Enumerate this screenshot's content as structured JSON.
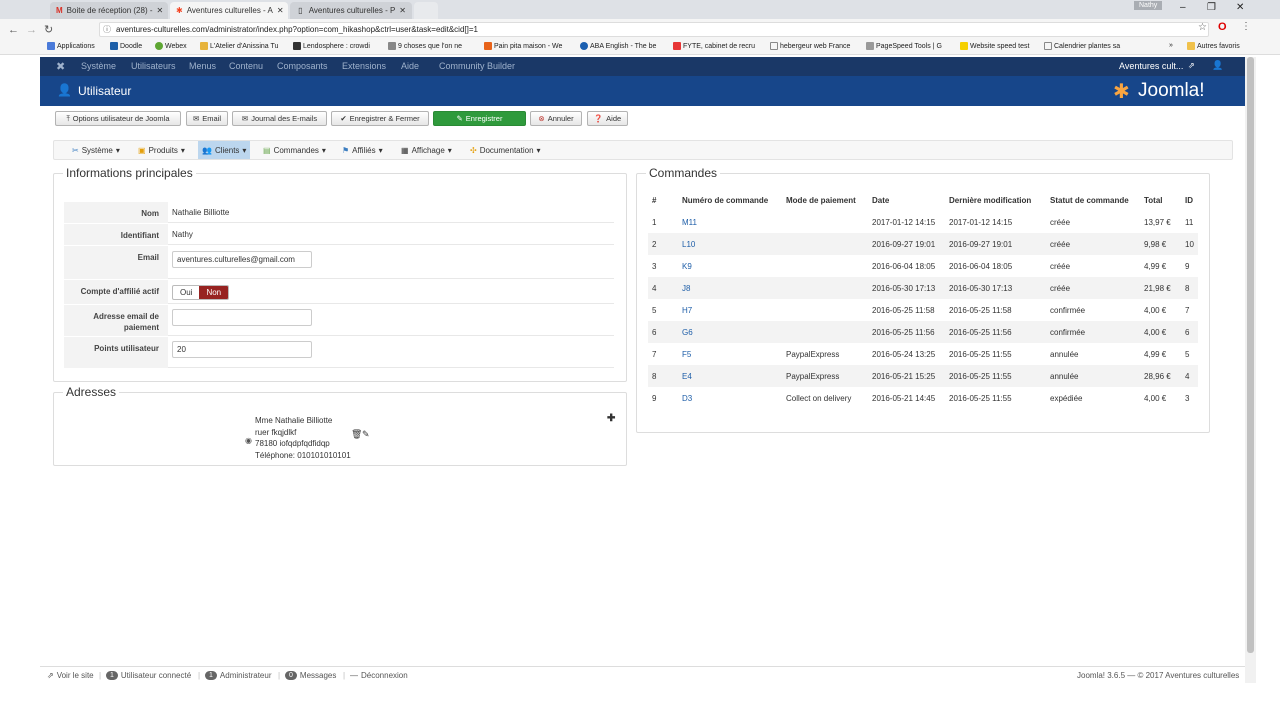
{
  "browser": {
    "tabs": [
      {
        "title": "Boite de réception (28) - ",
        "icon": "gmail-icon"
      },
      {
        "title": "Aventures culturelles - A",
        "icon": "joomla-icon"
      },
      {
        "title": "Aventures culturelles - P",
        "icon": "page-icon"
      }
    ],
    "user_label": "Nathy",
    "url": "aventures-culturelles.com/administrator/index.php?option=com_hikashop&ctrl=user&task=edit&cid[]=1",
    "bookmarks": [
      "Applications",
      "Doodle",
      "Webex",
      "L'Atelier d'Anissina Tu",
      "Lendosphere : crowdi",
      "9 choses que l'on ne",
      "Pain pita maison - We",
      "ABA English - The be",
      "FYTE, cabinet de recru",
      "hebergeur web France",
      "PageSpeed Tools | G",
      "Website speed test",
      "Calendrier plantes sa"
    ],
    "bookmarks_overflow": "»",
    "other_bookmarks": "Autres favoris"
  },
  "joomla": {
    "menu": [
      "Système",
      "Utilisateurs",
      "Menus",
      "Contenu",
      "Composants",
      "Extensions",
      "Aide",
      "Community Builder"
    ],
    "site_name": "Aventures cult...",
    "page_title": "Utilisateur",
    "logo_text": "Joomla!",
    "toolbar": {
      "options": "Options utilisateur de Joomla",
      "email": "Email",
      "journal": "Journal des E-mails",
      "save_close": "Enregistrer & Fermer",
      "save": "Enregistrer",
      "cancel": "Annuler",
      "help": "Aide"
    },
    "subnav": [
      "Système",
      "Produits",
      "Clients",
      "Commandes",
      "Affiliés",
      "Affichage",
      "Documentation"
    ]
  },
  "info": {
    "legend": "Informations principales",
    "name_label": "Nom",
    "name": "Nathalie Billiotte",
    "login_label": "Identifiant",
    "login": "Nathy",
    "email_label": "Email",
    "email": "aventures.culturelles@gmail.com",
    "affiliate_label": "Compte d'affilié actif",
    "yes": "Oui",
    "no": "Non",
    "payment_email_label": "Adresse email de paiement",
    "payment_email": "",
    "points_label": "Points utilisateur",
    "points": "20"
  },
  "addresses": {
    "legend": "Adresses",
    "name": "Mme Nathalie Billiotte",
    "street": "ruer fkqjdlkf",
    "city": "78180 iofqdpfqdfidqp",
    "phone": "Téléphone: 010101010101"
  },
  "orders": {
    "legend": "Commandes",
    "columns": [
      "#",
      "Numéro de commande",
      "Mode de paiement",
      "Date",
      "Dernière modification",
      "Statut de commande",
      "Total",
      "ID"
    ],
    "rows": [
      [
        "1",
        "M11",
        "",
        "2017-01-12 14:15",
        "2017-01-12 14:15",
        "créée",
        "13,97 €",
        "11"
      ],
      [
        "2",
        "L10",
        "",
        "2016-09-27 19:01",
        "2016-09-27 19:01",
        "créée",
        "9,98 €",
        "10"
      ],
      [
        "3",
        "K9",
        "",
        "2016-06-04 18:05",
        "2016-06-04 18:05",
        "créée",
        "4,99 €",
        "9"
      ],
      [
        "4",
        "J8",
        "",
        "2016-05-30 17:13",
        "2016-05-30 17:13",
        "créée",
        "21,98 €",
        "8"
      ],
      [
        "5",
        "H7",
        "",
        "2016-05-25 11:58",
        "2016-05-25 11:58",
        "confirmée",
        "4,00 €",
        "7"
      ],
      [
        "6",
        "G6",
        "",
        "2016-05-25 11:56",
        "2016-05-25 11:56",
        "confirmée",
        "4,00 €",
        "6"
      ],
      [
        "7",
        "F5",
        "PaypalExpress",
        "2016-05-24 13:25",
        "2016-05-25 11:55",
        "annulée",
        "4,99 €",
        "5"
      ],
      [
        "8",
        "E4",
        "PaypalExpress",
        "2016-05-21 15:25",
        "2016-05-25 11:55",
        "annulée",
        "28,96 €",
        "4"
      ],
      [
        "9",
        "D3",
        "Collect on delivery",
        "2016-05-21 14:45",
        "2016-05-25 11:55",
        "expédiée",
        "4,00 €",
        "3"
      ]
    ]
  },
  "statusbar": {
    "view_site": "Voir le site",
    "users_count": "1",
    "users_label": "Utilisateur connecté",
    "admins_count": "1",
    "admins_label": "Administrateur",
    "messages_count": "0",
    "messages_label": "Messages",
    "logout": "Déconnexion",
    "copyright": "Joomla! 3.6.5 — © 2017 Aventures culturelles"
  }
}
